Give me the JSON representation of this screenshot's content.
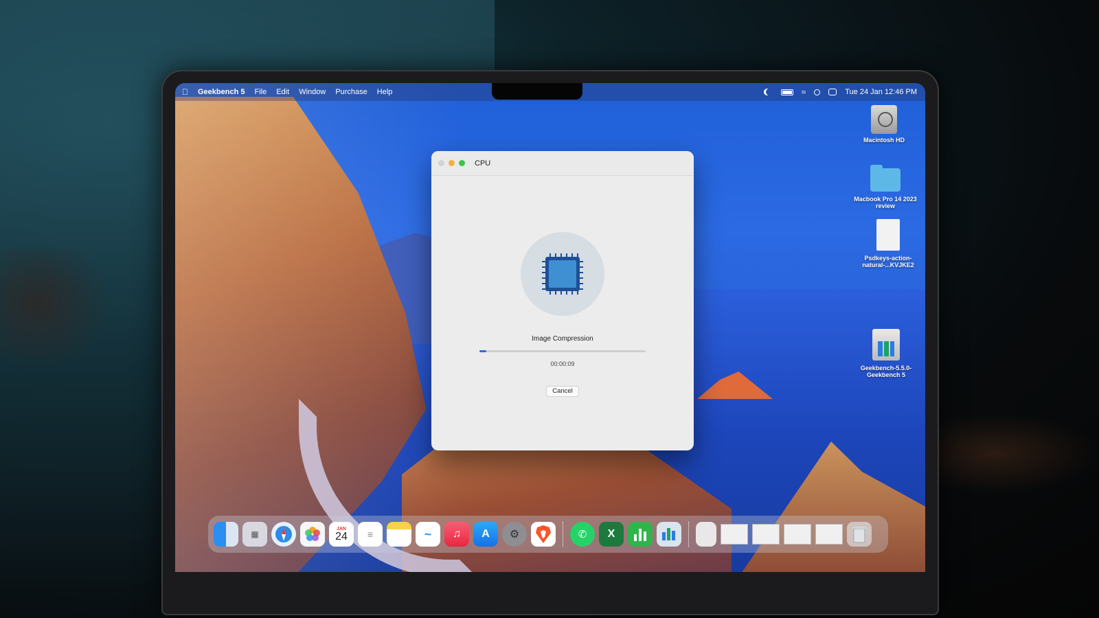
{
  "menubar": {
    "items": [
      "Geekbench 5",
      "File",
      "Edit",
      "Window",
      "Purchase",
      "Help"
    ],
    "datetime": "Tue 24 Jan  12:46 PM"
  },
  "desktop_icons": [
    {
      "label": "Macintosh HD",
      "icon": "hard-drive-icon"
    },
    {
      "label": "Macbook Pro 14 2023 review",
      "icon": "folder-icon"
    },
    {
      "label": "Psdkeys-action-natural-...KVJKE2",
      "icon": "document-icon"
    },
    {
      "label": "Geekbench-5.5.0-Geekbench 5",
      "icon": "geekbench-icon"
    }
  ],
  "window": {
    "title": "CPU",
    "test_name": "Image Compression",
    "progress": 0.04,
    "elapsed": "00:00:09",
    "cancel_label": "Cancel"
  },
  "dock": {
    "calendar_month": "JAN",
    "calendar_day": "24"
  }
}
